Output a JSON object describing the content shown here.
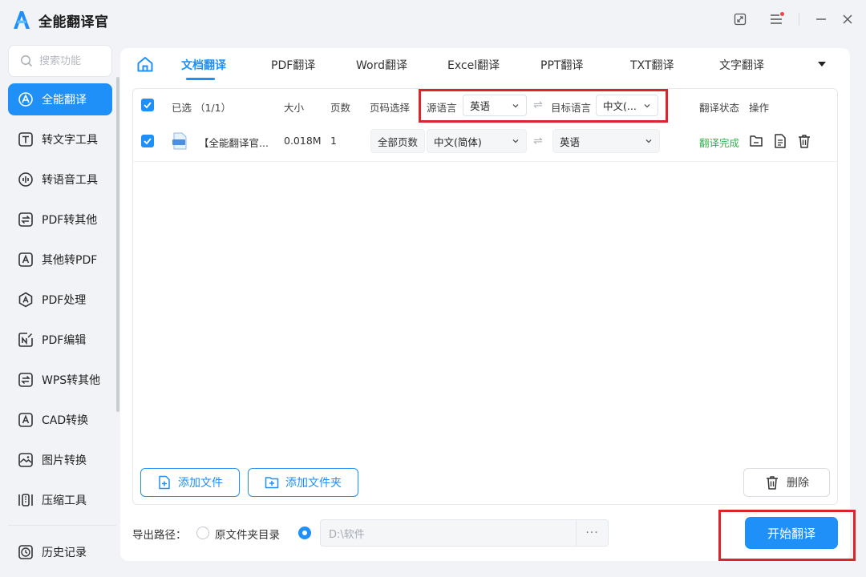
{
  "app": {
    "title": "全能翻译官"
  },
  "colors": {
    "accent": "#1e90f7",
    "success": "#2fb34a",
    "highlight": "#d9252b"
  },
  "search": {
    "placeholder": "搜索功能"
  },
  "sidebar": {
    "items": [
      {
        "label": "全能翻译",
        "icon": "translate-icon",
        "active": true
      },
      {
        "label": "转文字工具",
        "icon": "text-icon"
      },
      {
        "label": "转语音工具",
        "icon": "audio-wave-icon"
      },
      {
        "label": "PDF转其他",
        "icon": "convert-icon"
      },
      {
        "label": "其他转PDF",
        "icon": "pdf-icon"
      },
      {
        "label": "PDF处理",
        "icon": "pdf-process-icon"
      },
      {
        "label": "PDF编辑",
        "icon": "edit-icon"
      },
      {
        "label": "WPS转其他",
        "icon": "wps-icon"
      },
      {
        "label": "CAD转换",
        "icon": "cad-icon"
      },
      {
        "label": "图片转换",
        "icon": "image-icon"
      },
      {
        "label": "压缩工具",
        "icon": "compress-icon"
      }
    ],
    "history": {
      "label": "历史记录",
      "icon": "history-icon"
    }
  },
  "tabs": [
    {
      "label": "文档翻译",
      "active": true
    },
    {
      "label": "PDF翻译"
    },
    {
      "label": "Word翻译"
    },
    {
      "label": "Excel翻译"
    },
    {
      "label": "PPT翻译"
    },
    {
      "label": "TXT翻译"
    },
    {
      "label": "文字翻译"
    }
  ],
  "table": {
    "headers": {
      "selected": "已选 （1/1）",
      "size": "大小",
      "pages": "页数",
      "page_select": "页码选择",
      "source_lang": "源语言",
      "target_lang": "目标语言",
      "status": "翻译状态",
      "actions": "操作"
    },
    "header_source_value": "英语",
    "header_target_value": "中文(...",
    "rows": [
      {
        "filename": "【全能翻译官...",
        "size": "0.018M",
        "pages": "1",
        "page_select": "全部页数",
        "source": "中文(简体)",
        "target": "英语",
        "status": "翻译完成",
        "file_type": "DOC"
      }
    ]
  },
  "buttons": {
    "add_file": "添加文件",
    "add_folder": "添加文件夹",
    "delete": "删除",
    "start": "开始翻译"
  },
  "footer": {
    "export_label": "导出路径：",
    "option_original": "原文件夹目录",
    "option_custom_selected": true,
    "path": "D:\\软件",
    "browse": "···"
  }
}
